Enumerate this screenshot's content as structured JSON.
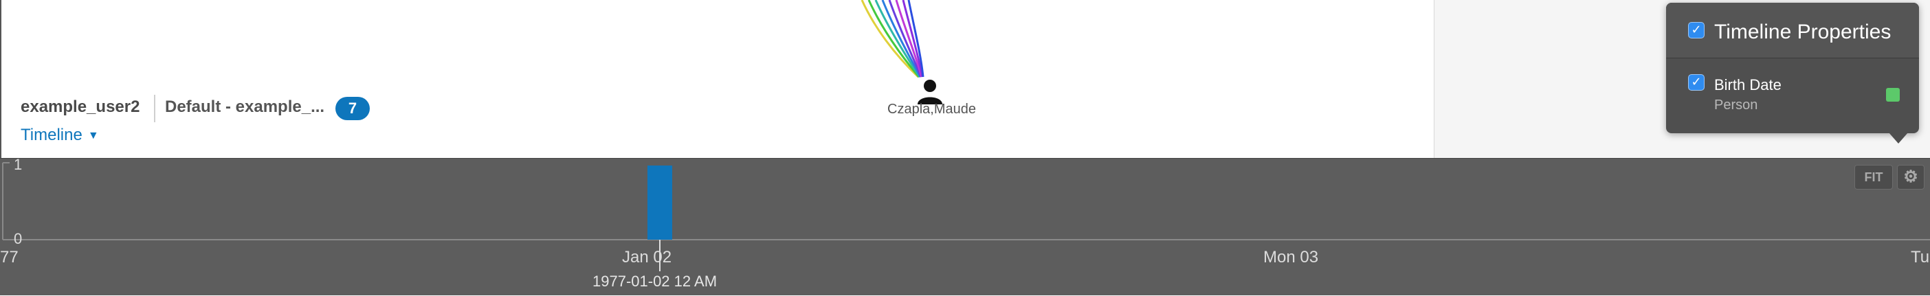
{
  "workspace": {
    "user": "example_user2",
    "name": "Default - example_...",
    "badge_count": "7",
    "view_menu_label": "Timeline"
  },
  "graph": {
    "node_label": "Czapla,Maude",
    "node_icon": "person-icon",
    "edge_colors": [
      "#e0d03a",
      "#45c93e",
      "#2fb8a8",
      "#2b7de0",
      "#6a3ee0",
      "#c03ad8",
      "#e02f6a",
      "#8a2fe0"
    ]
  },
  "timeline_properties": {
    "title": "Timeline Properties",
    "title_checked": true,
    "properties": [
      {
        "name": "Birth Date",
        "concept": "Person",
        "checked": true,
        "color": "#5cc96a"
      }
    ]
  },
  "timeline": {
    "y_ticks": [
      "1",
      "0"
    ],
    "x_labels": [
      "77",
      "Jan 02",
      "Mon 03",
      "Tu"
    ],
    "cursor_label": "1977-01-02 12 AM",
    "fit_label": "FIT",
    "settings_icon": "gear-icon",
    "bar_color": "#0e76bc",
    "histogram": [
      {
        "date": "1977-01-02",
        "count": 1
      }
    ]
  }
}
